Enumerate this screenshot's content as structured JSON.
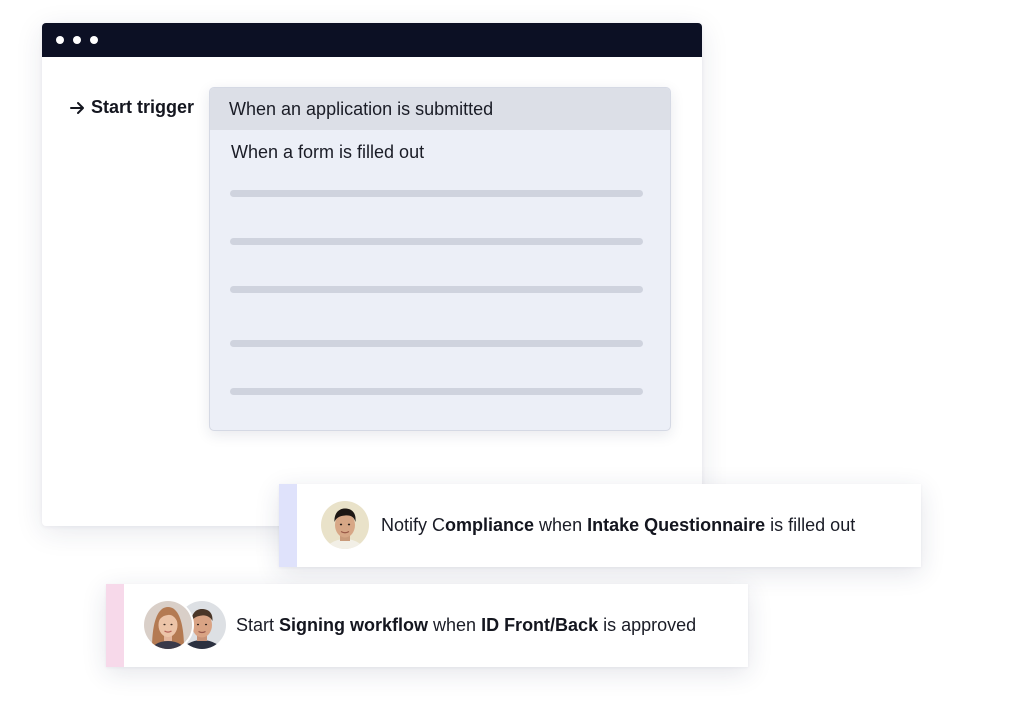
{
  "window": {
    "dots": [
      "dot",
      "dot",
      "dot"
    ]
  },
  "trigger": {
    "label": "Start trigger",
    "icon": "arrow-right-icon"
  },
  "dropdown": {
    "selected": "When an application is submitted",
    "options": [
      "When a form is filled out"
    ]
  },
  "cards": [
    {
      "accent_color": "#dfe2fb",
      "avatar": "avatar-man",
      "parts": [
        {
          "text": "Notify C",
          "bold": false
        },
        {
          "text": "ompliance",
          "bold": true
        },
        {
          "text": " when ",
          "bold": false
        },
        {
          "text": "Intake Questionnaire",
          "bold": true
        },
        {
          "text": " is filled out",
          "bold": false
        }
      ]
    },
    {
      "accent_color": "#f7d9ea",
      "avatars": [
        "avatar-woman",
        "avatar-man-2"
      ],
      "parts": [
        {
          "text": "Start ",
          "bold": false
        },
        {
          "text": "Signing workflow",
          "bold": true
        },
        {
          "text": " when ",
          "bold": false
        },
        {
          "text": "ID Front/Back",
          "bold": true
        },
        {
          "text": " is approved",
          "bold": false
        }
      ]
    }
  ],
  "colors": {
    "titlebar": "#0c1024",
    "dropdown_bg": "#eceff7",
    "selected_bg": "#dcdfe7",
    "placeholder": "#cfd3de"
  }
}
